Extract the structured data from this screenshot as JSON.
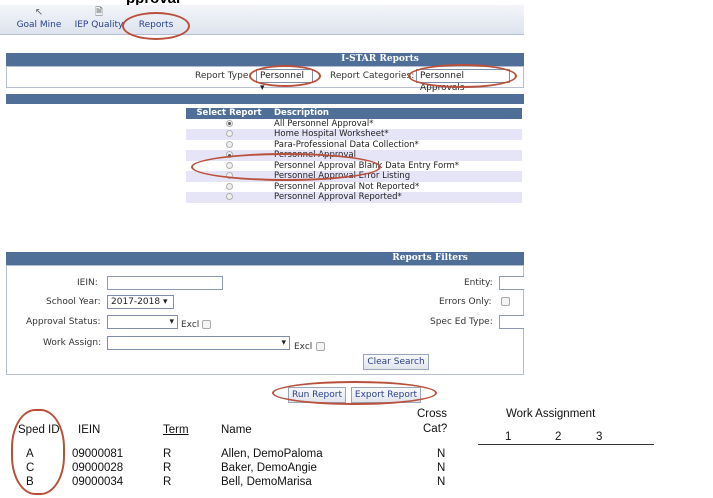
{
  "page": {
    "title_cut": "pproval"
  },
  "toolbar": {
    "items": [
      {
        "label": "Goal Mine",
        "icon": "cursor-icon"
      },
      {
        "label": "IEP Quality",
        "icon": "document-icon"
      },
      {
        "label": "Reports",
        "icon": ""
      }
    ]
  },
  "istar": {
    "title": "I-STAR Reports",
    "report_type_label": "Report Type:",
    "report_type_value": "Personnel",
    "report_categories_label": "Report Categories:",
    "report_categories_value": "Personnel Approvals"
  },
  "report_table": {
    "header_select": "Select Report",
    "header_description": "Description",
    "rows": [
      {
        "description": "All Personnel Approval*",
        "selected": false
      },
      {
        "description": "Home Hospital Worksheet*",
        "selected": false
      },
      {
        "description": "Para-Professional Data Collection*",
        "selected": false
      },
      {
        "description": "Personnel Approval",
        "selected": true
      },
      {
        "description": "Personnel Approval Blank Data Entry Form*",
        "selected": false
      },
      {
        "description": "Personnel Approval Error Listing",
        "selected": false
      },
      {
        "description": "Personnel Approval Not Reported*",
        "selected": false
      },
      {
        "description": "Personnel Approval Reported*",
        "selected": false
      }
    ]
  },
  "filters": {
    "title": "Reports Filters",
    "iein_label": "IEIN:",
    "school_year_label": "School Year:",
    "school_year_value": "2017-2018",
    "approval_status_label": "Approval Status:",
    "work_assign_label": "Work Assign:",
    "excl_label": "Excl",
    "entity_label": "Entity:",
    "errors_only_label": "Errors Only:",
    "spec_ed_type_label": "Spec Ed Type:",
    "clear_search": "Clear Search"
  },
  "actions": {
    "run_report": "Run Report",
    "export_report": "Export Report"
  },
  "results": {
    "columns": {
      "sped_id": "Sped ID",
      "iein": "IEIN",
      "term": "Term",
      "name": "Name",
      "cross_cat_1": "Cross",
      "cross_cat_2": "Cat?",
      "work_assignment": "Work Assignment",
      "wa1": "1",
      "wa2": "2",
      "wa3": "3"
    },
    "rows": [
      {
        "sped_id": "A",
        "iein": "09000081",
        "term": "R",
        "name": "Allen, DemoPaloma",
        "cross": "N"
      },
      {
        "sped_id": "C",
        "iein": "09000028",
        "term": "R",
        "name": "Baker, DemoAngie",
        "cross": "N"
      },
      {
        "sped_id": "B",
        "iein": "09000034",
        "term": "R",
        "name": "Bell, DemoMarisa",
        "cross": "N"
      }
    ]
  },
  "colors": {
    "header_blue": "#4f6f99",
    "annotation_red": "#b9503c",
    "row_alt": "#e6e4f7"
  }
}
